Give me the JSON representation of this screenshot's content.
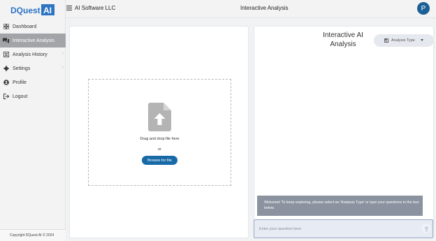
{
  "brand": {
    "logo_text_dquest": "DQuest",
    "logo_text_ai": "AI",
    "primary_color": "#1769a8",
    "logo_color": "#2d74c4"
  },
  "sidebar": {
    "items": [
      {
        "label": "Dashboard",
        "icon": "dashboard-icon",
        "active": false
      },
      {
        "label": "Interactive Analysis",
        "icon": "chat-icon",
        "active": true
      },
      {
        "label": "Analysis History",
        "icon": "history-icon",
        "active": false
      },
      {
        "label": "Settings",
        "icon": "gear-icon",
        "active": false
      },
      {
        "label": "Profile",
        "icon": "user-icon",
        "active": false
      },
      {
        "label": "Logout",
        "icon": "logout-icon",
        "active": false
      }
    ],
    "copyright": "Copyright DQuest AI © 2024"
  },
  "header": {
    "org_name": "AI Software LLC",
    "title": "Interactive Analysis",
    "avatar_initial": "P"
  },
  "upload": {
    "drop_text": "Drag and drop file here",
    "or_text": "or",
    "browse_label": "Browse for file"
  },
  "analysis": {
    "title": "Interactive AI Analysis",
    "type_dropdown_label": "Analysis Type",
    "welcome_message": "Welcome! To keep exploring, please select an 'Analysis Type' or type your questions in the box below.",
    "question_placeholder": "Enter your question here"
  }
}
